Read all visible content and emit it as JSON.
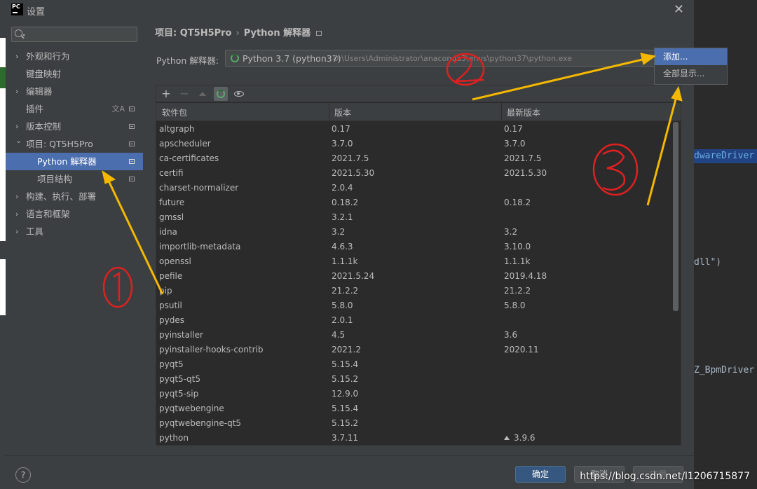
{
  "window": {
    "app_icon": "PC",
    "title": "设置"
  },
  "sidebar": {
    "search_placeholder": "",
    "items": [
      {
        "label": "外观和行为",
        "expandable": true
      },
      {
        "label": "键盘映射",
        "expandable": false
      },
      {
        "label": "编辑器",
        "expandable": true
      },
      {
        "label": "插件",
        "expandable": false
      },
      {
        "label": "版本控制",
        "expandable": true
      },
      {
        "label": "项目: QT5H5Pro",
        "expandable": true,
        "expanded": true
      },
      {
        "label": "Python 解释器",
        "child": true,
        "selected": true
      },
      {
        "label": "项目结构",
        "child": true
      },
      {
        "label": "构建、执行、部署",
        "expandable": true
      },
      {
        "label": "语言和框架",
        "expandable": true
      },
      {
        "label": "工具",
        "expandable": true
      }
    ]
  },
  "breadcrumb": {
    "project": "项目: QT5H5Pro",
    "separator": "›",
    "page": "Python 解释器"
  },
  "interpreter": {
    "label": "Python 解释器:",
    "name": "Python 3.7 (python37)",
    "path": "D:\\Users\\Administrator\\anaconda3\\envs\\python37\\python.exe"
  },
  "interpreter_menu": {
    "options": [
      "添加...",
      "全部显示..."
    ],
    "highlighted": 0
  },
  "package_table": {
    "columns": [
      "软件包",
      "版本",
      "最新版本"
    ],
    "rows": [
      [
        "altgraph",
        "0.17",
        "0.17"
      ],
      [
        "apscheduler",
        "3.7.0",
        "3.7.0"
      ],
      [
        "ca-certificates",
        "2021.7.5",
        "2021.7.5"
      ],
      [
        "certifi",
        "2021.5.30",
        "2021.5.30"
      ],
      [
        "charset-normalizer",
        "2.0.4",
        ""
      ],
      [
        "future",
        "0.18.2",
        "0.18.2"
      ],
      [
        "gmssl",
        "3.2.1",
        ""
      ],
      [
        "idna",
        "3.2",
        "3.2"
      ],
      [
        "importlib-metadata",
        "4.6.3",
        "3.10.0"
      ],
      [
        "openssl",
        "1.1.1k",
        "1.1.1k"
      ],
      [
        "pefile",
        "2021.5.24",
        "2019.4.18"
      ],
      [
        "pip",
        "21.2.2",
        "21.2.2"
      ],
      [
        "psutil",
        "5.8.0",
        "5.8.0"
      ],
      [
        "pydes",
        "2.0.1",
        ""
      ],
      [
        "pyinstaller",
        "4.5",
        "3.6"
      ],
      [
        "pyinstaller-hooks-contrib",
        "2021.2",
        "2020.11"
      ],
      [
        "pyqt5",
        "5.15.4",
        ""
      ],
      [
        "pyqt5-qt5",
        "5.15.2",
        ""
      ],
      [
        "pyqt5-sip",
        "12.9.0",
        ""
      ],
      [
        "pyqtwebengine",
        "5.15.4",
        ""
      ],
      [
        "pyqtwebengine-qt5",
        "5.15.2",
        ""
      ],
      [
        "python",
        "3.7.11",
        "3.9.6"
      ]
    ],
    "upgrade_row": "python"
  },
  "toolbar": {
    "add": "+",
    "remove": "−"
  },
  "footer": {
    "help": "?",
    "ok": "确定",
    "cancel": "取消",
    "apply": "应用"
  },
  "editor_background": {
    "line1": "dwareDriver",
    "line2": "dll\")",
    "line3": "Z_BpmDriver"
  },
  "watermark": "https://blog.csdn.net/l1206715877",
  "colors": {
    "accent": "#4b6eaf",
    "ok_button": "#365880",
    "annotation_red": "#e02020",
    "annotation_arrow": "#f5b800"
  }
}
